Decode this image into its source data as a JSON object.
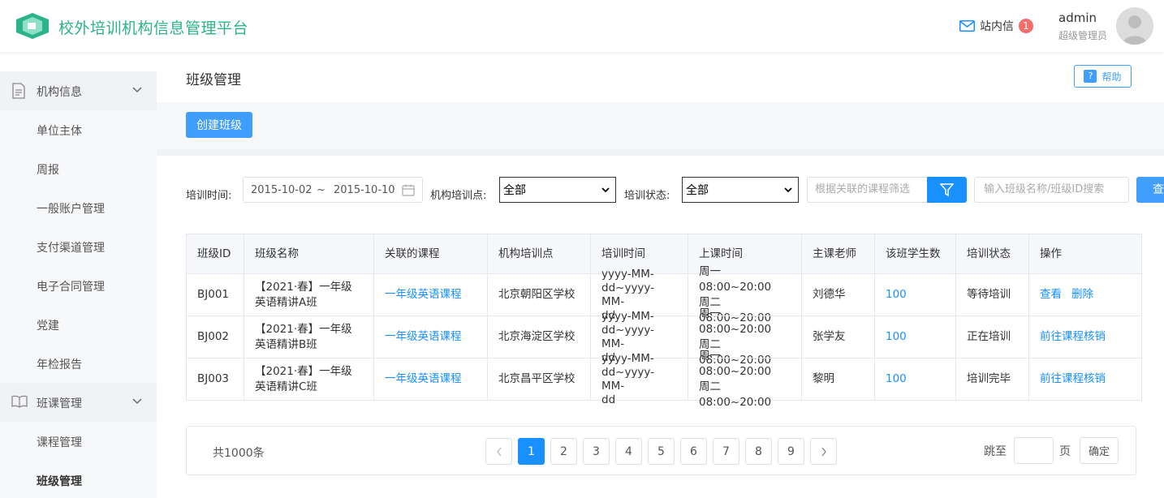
{
  "header": {
    "title": "校外培训机构信息管理平台",
    "mail_label": "站内信",
    "mail_count": "1",
    "user_name": "admin",
    "user_role": "超级管理员",
    "accent": "#2bb38a"
  },
  "sidebar": {
    "group1": {
      "label": "机构信息",
      "icon": "document-icon"
    },
    "group1_items": [
      "单位主体",
      "周报",
      "一般账户管理",
      "支付渠道管理",
      "电子合同管理",
      "党建",
      "年检报告"
    ],
    "group2": {
      "label": "班课管理",
      "icon": "book-icon"
    },
    "group2_items": [
      "课程管理",
      "班级管理"
    ],
    "active_item": "班级管理"
  },
  "page": {
    "title": "班级管理",
    "help_label": "帮助",
    "create_label": "创建班级"
  },
  "filters": {
    "time_label": "培训时间:",
    "date_start": "2015-10-02",
    "date_sep": "~",
    "date_end": "2015-10-10",
    "site_label": "机构培训点:",
    "site_value": "全部",
    "status_label": "培训状态:",
    "status_value": "全部",
    "course_placeholder": "根据关联的课程筛选",
    "class_placeholder": "输入班级名称/班级ID搜索",
    "query_label": "查"
  },
  "table": {
    "headers": [
      "班级ID",
      "班级名称",
      "关联的课程",
      "机构培训点",
      "培训时间",
      "上课时间",
      "主课老师",
      "该班学生数",
      "培训状态",
      "操作"
    ],
    "rows": [
      {
        "id": "BJ001",
        "name_line1": "【2021·春】一年级",
        "name_line2": "英语精讲A班",
        "course": "一年级英语课程",
        "site": "北京朝阳区学校",
        "time_line1": "yyyy-MM-",
        "time_line2": "dd~yyyy-MM-",
        "time_line3": "dd",
        "class_line1": "周一 08:00~20:00",
        "class_line2": "周二 08:00~20:00",
        "teacher": "刘德华",
        "students": "100",
        "status": "等待培训",
        "op1": "查看",
        "op2": "删除"
      },
      {
        "id": "BJ002",
        "name_line1": "【2021·春】一年级",
        "name_line2": "英语精讲B班",
        "course": "一年级英语课程",
        "site": "北京海淀区学校",
        "time_line1": "yyyy-MM-",
        "time_line2": "dd~yyyy-MM-",
        "time_line3": "dd",
        "class_line1": "周一 08:00~20:00",
        "class_line2": "周二 08:00~20:00",
        "teacher": "张学友",
        "students": "100",
        "status": "正在培训",
        "op1": "前往课程核销",
        "op2": ""
      },
      {
        "id": "BJ003",
        "name_line1": "【2021·春】一年级",
        "name_line2": "英语精讲C班",
        "course": "一年级英语课程",
        "site": "北京昌平区学校",
        "time_line1": "yyyy-MM-",
        "time_line2": "dd~yyyy-MM-",
        "time_line3": "dd",
        "class_line1": "周一 08:00~20:00",
        "class_line2": "周二 08:00~20:00",
        "teacher": "黎明",
        "students": "100",
        "status": "培训完毕",
        "op1": "前往课程核销",
        "op2": ""
      }
    ]
  },
  "pagination": {
    "total": "共1000条",
    "pages": [
      "1",
      "2",
      "3",
      "4",
      "5",
      "6",
      "7",
      "8",
      "9"
    ],
    "current": "1",
    "jump_label": "跳至",
    "page_unit": "页",
    "confirm_label": "确定"
  }
}
